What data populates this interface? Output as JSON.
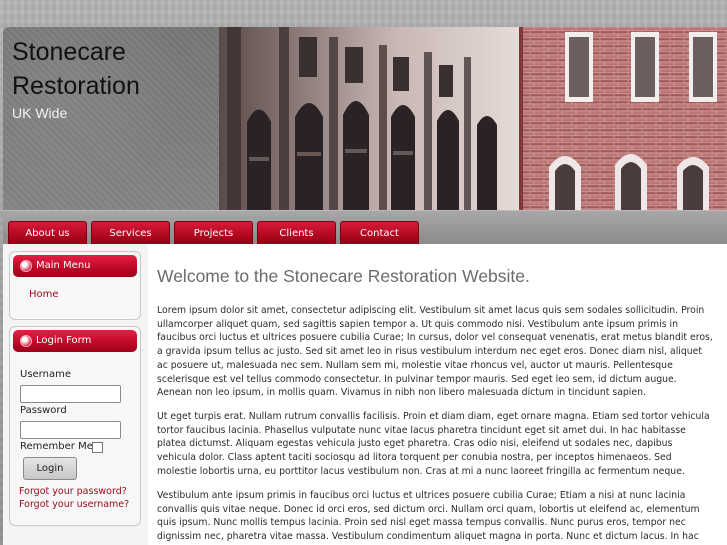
{
  "site": {
    "title": "Stonecare Restoration",
    "subtitle": "UK Wide"
  },
  "nav": {
    "tabs": [
      {
        "label": "About us"
      },
      {
        "label": "Services"
      },
      {
        "label": "Projects"
      },
      {
        "label": "Clients"
      },
      {
        "label": "Contact"
      }
    ]
  },
  "sidebar": {
    "main_menu": {
      "title": "Main Menu",
      "items": [
        {
          "label": "Home"
        }
      ]
    },
    "login_form": {
      "title": "Login Form",
      "username_label": "Username",
      "password_label": "Password",
      "remember_label": "Remember Me",
      "login_button": "Login",
      "forgot_password": "Forgot your password?",
      "forgot_username": "Forgot your username?"
    }
  },
  "main": {
    "heading": "Welcome to the Stonecare Restoration Website.",
    "paragraphs": [
      "Lorem ipsum dolor sit amet, consectetur adipiscing elit. Vestibulum sit amet lacus quis sem sodales sollicitudin. Proin ullamcorper aliquet quam, sed sagittis sapien tempor a. Ut quis commodo nisi. Vestibulum ante ipsum primis in faucibus orci luctus et ultrices posuere cubilia Curae; In cursus, dolor vel consequat venenatis, erat metus blandit eros, a gravida ipsum tellus ac justo. Sed sit amet leo in risus vestibulum interdum nec eget eros. Donec diam nisl, aliquet ac posuere ut, malesuada nec sem. Nullam sem mi, molestie vitae rhoncus vel, auctor ut mauris. Pellentesque scelerisque est vel tellus commodo consectetur. In pulvinar tempor mauris. Sed eget leo sem, id dictum augue. Aenean non leo ipsum, in mollis quam. Vivamus in nibh non libero malesuada dictum in tincidunt sapien.",
      "Ut eget turpis erat. Nullam rutrum convallis facilisis. Proin et diam diam, eget ornare magna. Etiam sed tortor vehicula tortor faucibus lacinia. Phasellus vulputate nunc vitae lacus pharetra tincidunt eget sit amet dui. In hac habitasse platea dictumst. Aliquam egestas vehicula justo eget pharetra. Cras odio nisi, eleifend ut sodales nec, dapibus vehicula dolor. Class aptent taciti sociosqu ad litora torquent per conubia nostra, per inceptos himenaeos. Sed molestie lobortis urna, eu porttitor lacus vestibulum non. Cras at mi a nunc laoreet fringilla ac fermentum neque.",
      "Vestibulum ante ipsum primis in faucibus orci luctus et ultrices posuere cubilia Curae; Etiam a nisi at nunc lacinia convallis quis vitae neque. Donec id orci eros, sed dictum orci. Nullam orci quam, lobortis ut eleifend ac, elementum quis ipsum. Nunc mollis tempus lacinia. Proin sed nisl eget massa tempus convallis. Nunc purus eros, tempor nec dignissim nec, pharetra vitae massa. Vestibulum condimentum aliquet magna in porta. Nunc et dictum lacus. In hac habitasse platea dictumst. Nullam risus mauris,"
    ]
  }
}
